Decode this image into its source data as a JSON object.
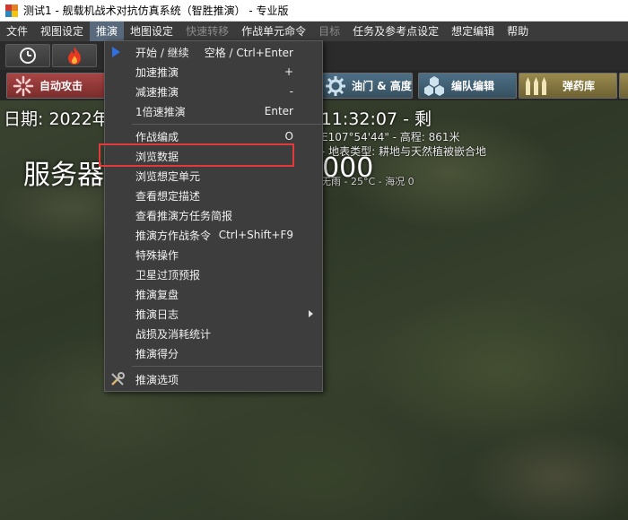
{
  "window": {
    "title": "测试1 - 舰载机战术对抗仿真系统（智胜推演） - 专业版"
  },
  "menubar": {
    "items": [
      {
        "label": "文件",
        "state": "normal"
      },
      {
        "label": "视图设定",
        "state": "normal"
      },
      {
        "label": "推演",
        "state": "active"
      },
      {
        "label": "地图设定",
        "state": "normal"
      },
      {
        "label": "快速转移",
        "state": "disabled"
      },
      {
        "label": "作战单元命令",
        "state": "normal"
      },
      {
        "label": "目标",
        "state": "disabled"
      },
      {
        "label": "任务及参考点设定",
        "state": "normal"
      },
      {
        "label": "想定编辑",
        "state": "normal"
      },
      {
        "label": "帮助",
        "state": "normal"
      }
    ]
  },
  "toolbar": {
    "clock_icon": "clock-icon",
    "fire_icon": "fire-icon",
    "auto_attack_label": "自动攻击",
    "throttle_label": "油门 & 高度",
    "formation_label": "编队编辑",
    "magazine_label": "弹药库"
  },
  "map": {
    "status_line": "日期: 2022年                                          lu): 03:32:07 - 当地时间: 11:32:07 - 剩",
    "server_label": "服务器",
    "server_value": "0000",
    "coord_line": "E107°54'44\" - 高程: 861米",
    "terrain_line": "- 地表类型:  耕地与天然植被嵌合地",
    "weather_line": "无雨 - 25°C - 海况 0"
  },
  "dropdown": {
    "items": [
      {
        "label": "开始 / 继续",
        "shortcut": "空格 / Ctrl+Enter",
        "icon": "play-icon"
      },
      {
        "label": "加速推演",
        "shortcut": "+"
      },
      {
        "label": "减速推演",
        "shortcut": "-"
      },
      {
        "label": "1倍速推演",
        "shortcut": "Enter"
      },
      {
        "label": "作战编成",
        "shortcut": "O"
      },
      {
        "label": "浏览数据",
        "shortcut": "",
        "highlighted": true
      },
      {
        "label": "浏览想定单元",
        "shortcut": ""
      },
      {
        "label": "查看想定描述",
        "shortcut": ""
      },
      {
        "label": "查看推演方任务简报",
        "shortcut": ""
      },
      {
        "label": "推演方作战条令",
        "shortcut": "Ctrl+Shift+F9"
      },
      {
        "label": "特殊操作",
        "shortcut": ""
      },
      {
        "label": "卫星过顶预报",
        "shortcut": ""
      },
      {
        "label": "推演复盘",
        "shortcut": ""
      },
      {
        "label": "推演日志",
        "shortcut": "",
        "submenu": true
      },
      {
        "label": "战损及消耗统计",
        "shortcut": ""
      },
      {
        "label": "推演得分",
        "shortcut": ""
      },
      {
        "label": "推演选项",
        "shortcut": "",
        "icon": "tools-icon"
      }
    ]
  },
  "colors": {
    "menu_bg": "#3b3b3b",
    "menu_active": "#596a7c",
    "dropdown_bg": "#3d3d3d",
    "highlight_box": "#e23a3a",
    "play_icon": "#2f6fde"
  }
}
